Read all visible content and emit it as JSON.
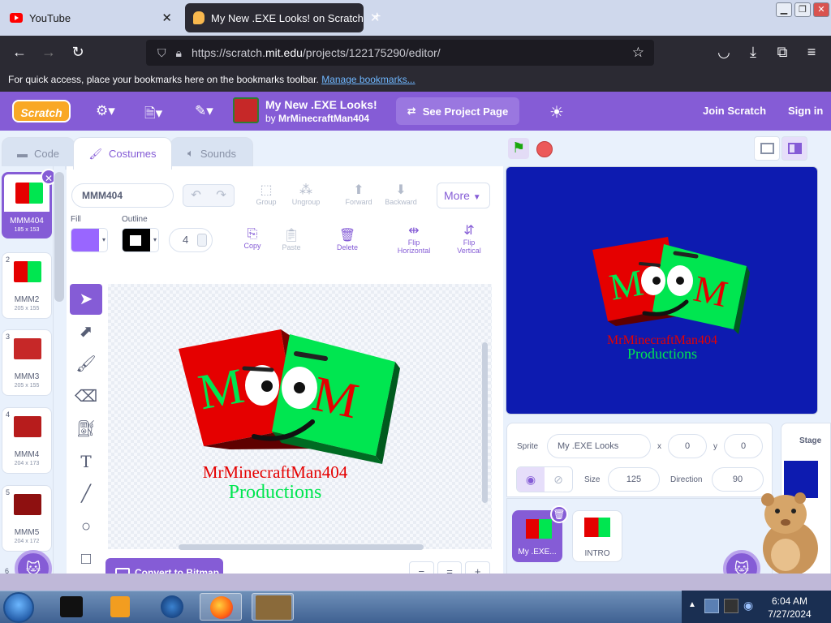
{
  "browser": {
    "tabs": [
      {
        "title": "YouTube"
      },
      {
        "title": "My New .EXE Looks! on Scratch"
      }
    ],
    "url_prefix": "https://scratch.",
    "url_domain": "mit.edu",
    "url_suffix": "/projects/122175290/editor/",
    "bookmarks_text": "For quick access, place your bookmarks here on the bookmarks toolbar.",
    "bookmarks_link": "Manage bookmarks..."
  },
  "menubar": {
    "logo": "Scratch",
    "project_title": "My New .EXE Looks!",
    "by": "by",
    "author": "MrMinecraftMan404",
    "see_project": "See Project Page",
    "join": "Join Scratch",
    "sign_in": "Sign in"
  },
  "editor_tabs": {
    "code": "Code",
    "costumes": "Costumes",
    "sounds": "Sounds"
  },
  "costumes": [
    {
      "num": "1",
      "name": "MMM404",
      "dims": "185 x 153",
      "color": "#c62828"
    },
    {
      "num": "2",
      "name": "MMM2",
      "dims": "205 x 155",
      "color": "#c62828"
    },
    {
      "num": "3",
      "name": "MMM3",
      "dims": "205 x 155",
      "color": "#b71c1c"
    },
    {
      "num": "4",
      "name": "MMM4",
      "dims": "204 x 173",
      "color": "#b71c1c"
    },
    {
      "num": "5",
      "name": "MMM5",
      "dims": "204 x 172",
      "color": "#8e1010"
    },
    {
      "num": "6",
      "name": "",
      "dims": "",
      "color": "#8e1010"
    }
  ],
  "paint": {
    "costume_name": "MMM404",
    "group": "Group",
    "ungroup": "Ungroup",
    "forward": "Forward",
    "backward": "Backward",
    "more": "More",
    "fill_label": "Fill",
    "outline_label": "Outline",
    "outline_width": "4",
    "copy": "Copy",
    "paste": "Paste",
    "delete": "Delete",
    "flip_h": "Flip Horizontal",
    "flip_v": "Flip Vertical",
    "convert": "Convert to Bitmap",
    "zoom_out": "−",
    "zoom_reset": "=",
    "zoom_in": "+",
    "fill_color": "#9966ff",
    "outline_color": "#000000"
  },
  "artwork": {
    "line1": "MrMinecraftMan404",
    "line2": "Productions",
    "letter": "M",
    "stage_line1": "MrMinecraftMan404"
  },
  "sprite_info": {
    "sprite_label": "Sprite",
    "sprite_name": "My .EXE Looks",
    "x_label": "x",
    "x": "0",
    "y_label": "y",
    "y": "0",
    "size_label": "Size",
    "size": "125",
    "direction_label": "Direction",
    "direction": "90"
  },
  "sprites": [
    {
      "name": "My .EXE..."
    },
    {
      "name": "INTRO"
    }
  ],
  "stage_panel": {
    "label": "Stage"
  },
  "taskbar": {
    "time": "6:04 AM",
    "date": "7/27/2024"
  },
  "colors": {
    "accent": "#855cd6",
    "stage_bg": "#0d1bb0",
    "red_box": "#e50000",
    "green_box": "#00e650"
  }
}
